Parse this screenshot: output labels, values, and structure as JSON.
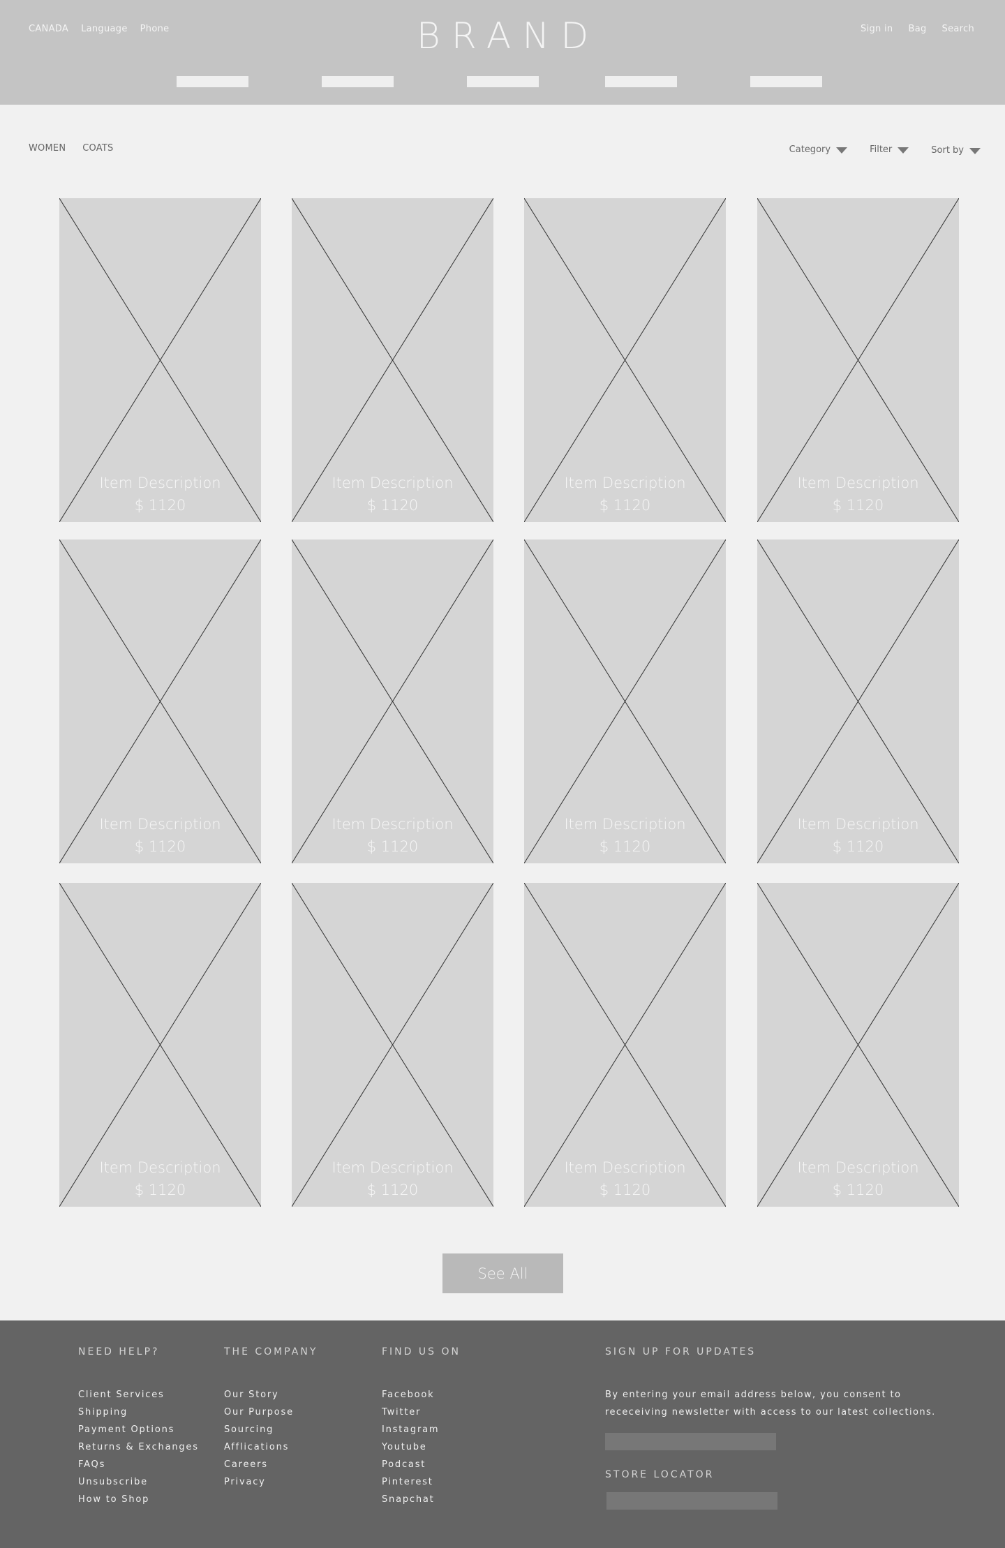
{
  "header": {
    "left_links": [
      "CANADA",
      "Language",
      "Phone"
    ],
    "brand": "BRAND",
    "right_links": [
      "Sign in",
      "Bag",
      "Search"
    ],
    "nav_items": [
      "",
      "",
      "",
      "",
      ""
    ]
  },
  "toolbar": {
    "breadcrumb": [
      "WOMEN",
      "COATS"
    ],
    "category_label": "Category",
    "filter_label": "Filter",
    "sort_label": "Sort by"
  },
  "products": [
    {
      "description": "Item Description",
      "price": "$ 1120"
    },
    {
      "description": "Item Description",
      "price": "$ 1120"
    },
    {
      "description": "Item Description",
      "price": "$ 1120"
    },
    {
      "description": "Item Description",
      "price": "$ 1120"
    },
    {
      "description": "Item Description",
      "price": "$ 1120"
    },
    {
      "description": "Item Description",
      "price": "$ 1120"
    },
    {
      "description": "Item Description",
      "price": "$ 1120"
    },
    {
      "description": "Item Description",
      "price": "$ 1120"
    },
    {
      "description": "Item Description",
      "price": "$ 1120"
    },
    {
      "description": "Item Description",
      "price": "$ 1120"
    },
    {
      "description": "Item Description",
      "price": "$ 1120"
    },
    {
      "description": "Item Description",
      "price": "$ 1120"
    }
  ],
  "see_all_label": "See All",
  "footer": {
    "need_help": {
      "title": "NEED HELP?",
      "items": [
        "Client Services",
        "Shipping",
        "Payment Options",
        "Returns & Exchanges",
        "FAQs",
        "Unsubscribe",
        "How to Shop"
      ]
    },
    "company": {
      "title": "THE COMPANY",
      "items": [
        "Our Story",
        "Our Purpose",
        "Sourcing",
        "Afflications",
        "Careers",
        "Privacy"
      ]
    },
    "find_us": {
      "title": "FIND US ON",
      "items": [
        "Facebook",
        "Twitter",
        "Instagram",
        "Youtube",
        "Podcast",
        "Pinterest",
        "Snapchat"
      ]
    },
    "signup": {
      "title": "SIGN UP FOR UPDATES",
      "text_line1": "By entering your email address below, you consent to",
      "text_line2": "receceiving newsletter with access to our latest collections.",
      "email_placeholder": ""
    },
    "store_locator": {
      "title": "STORE LOCATOR",
      "placeholder": ""
    }
  },
  "colors": {
    "header_bg": "#c4c4c4",
    "page_bg": "#f1f1f1",
    "card_bg": "#d5d5d5",
    "button_bg": "#b9b9b9",
    "footer_bg": "#646464"
  }
}
